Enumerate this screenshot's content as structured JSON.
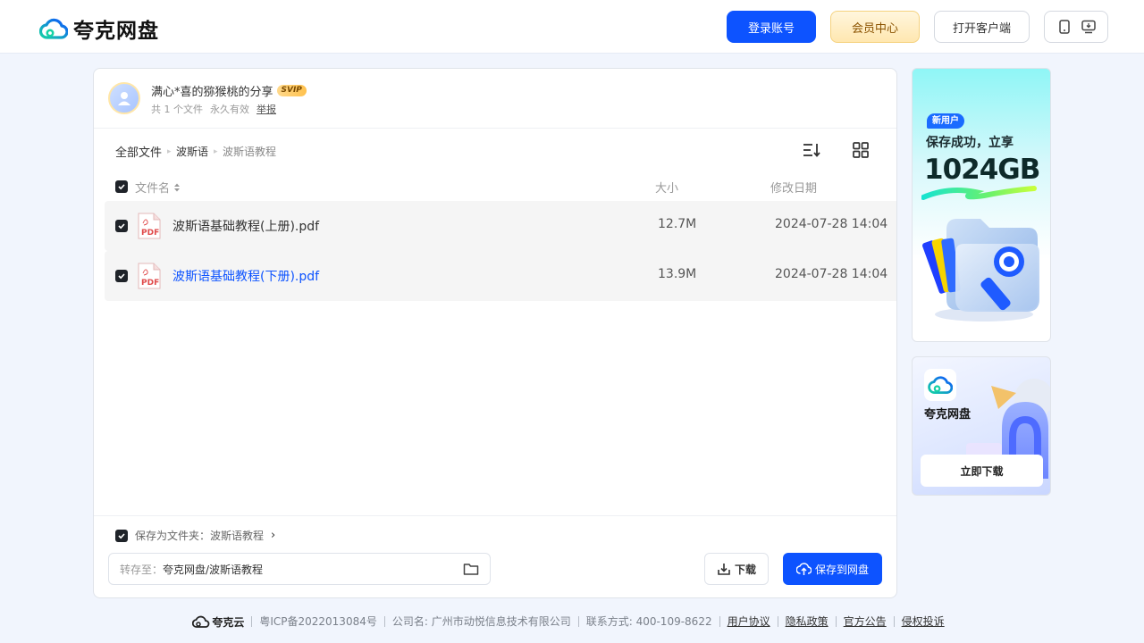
{
  "header": {
    "logo_text": "夸克网盘",
    "login_label": "登录账号",
    "member_label": "会员中心",
    "client_label": "打开客户端",
    "device_icons": [
      "phone-icon",
      "desktop-download-icon"
    ]
  },
  "share": {
    "title": "满心*喜的猕猴桃的分享",
    "vip_badge": "SVIP",
    "file_count": "共 1 个文件",
    "validity": "永久有效",
    "report": "举报"
  },
  "breadcrumb": {
    "all": "全部文件",
    "mid": "波斯语",
    "current": "波斯语教程"
  },
  "columns": {
    "name": "文件名",
    "size": "大小",
    "date": "修改日期"
  },
  "files": [
    {
      "name": "波斯语基础教程(上册).pdf",
      "size": "12.7M",
      "date": "2024-07-28 14:04",
      "icon": "pdf-icon"
    },
    {
      "name": "波斯语基础教程(下册).pdf",
      "size": "13.9M",
      "date": "2024-07-28 14:04",
      "icon": "pdf-icon"
    }
  ],
  "save": {
    "as_folder": "保存为文件夹：波斯语教程",
    "arrow": "›",
    "dest_label": "转存至：",
    "dest_value": "夸克网盘/波斯语教程",
    "download_label": "下载",
    "save_label": "保存到网盘"
  },
  "ads": {
    "ad1_badge": "新用户",
    "ad1_line": "保存成功，立享",
    "ad1_big": "1024GB",
    "ad2_name": "夸克网盘",
    "ad2_button": "立即下载"
  },
  "footer": {
    "brand": "夸克云",
    "icp": "粤ICP备2022013084号",
    "company": "公司名: 广州市动悦信息技术有限公司",
    "contact": "联系方式: 400-109-8622",
    "links": [
      "用户协议",
      "隐私政策",
      "官方公告",
      "侵权投诉"
    ]
  },
  "colors": {
    "accent": "#0d53ff",
    "background": "#f1f5fd"
  }
}
